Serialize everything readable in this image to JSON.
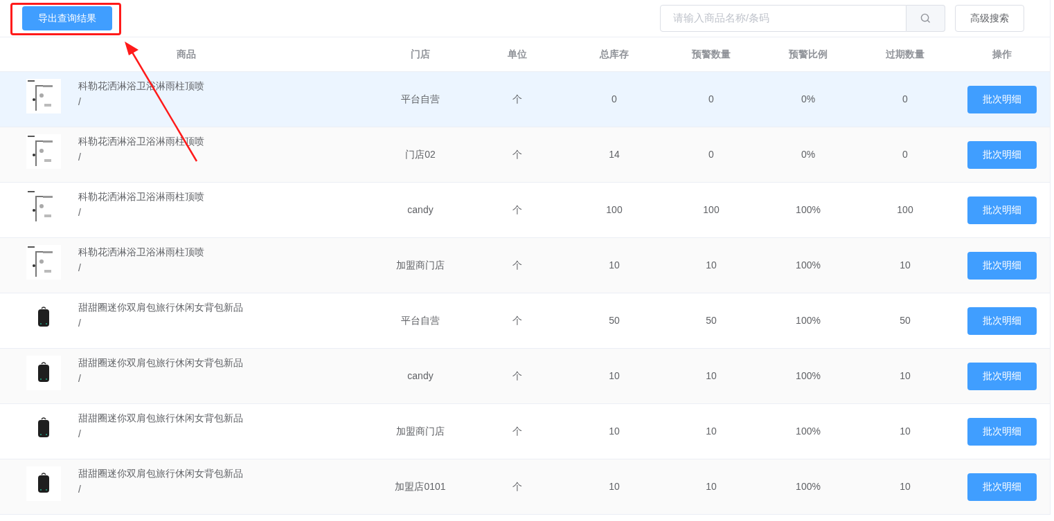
{
  "toolbar": {
    "export_button": "导出查询结果",
    "search": {
      "placeholder": "请输入商品名称/条码"
    },
    "advanced_search_button": "高级搜索"
  },
  "table": {
    "columns": [
      "商品",
      "门店",
      "单位",
      "总库存",
      "预警数量",
      "预警比例",
      "过期数量",
      "操作"
    ],
    "rows": [
      {
        "kind": "shower",
        "name": "科勒花洒淋浴卫浴淋雨柱顶喷",
        "code": "/",
        "store": "平台自营",
        "unit": "个",
        "stock": "0",
        "warn_qty": "0",
        "warn_ratio": "0%",
        "expired": "0",
        "action": "批次明细",
        "selected": true
      },
      {
        "kind": "shower",
        "name": "科勒花洒淋浴卫浴淋雨柱顶喷",
        "code": "/",
        "store": "门店02",
        "unit": "个",
        "stock": "14",
        "warn_qty": "0",
        "warn_ratio": "0%",
        "expired": "0",
        "action": "批次明细",
        "selected": false
      },
      {
        "kind": "shower",
        "name": "科勒花洒淋浴卫浴淋雨柱顶喷",
        "code": "/",
        "store": "candy",
        "unit": "个",
        "stock": "100",
        "warn_qty": "100",
        "warn_ratio": "100%",
        "expired": "100",
        "action": "批次明细",
        "selected": false
      },
      {
        "kind": "shower",
        "name": "科勒花洒淋浴卫浴淋雨柱顶喷",
        "code": "/",
        "store": "加盟商门店",
        "unit": "个",
        "stock": "10",
        "warn_qty": "10",
        "warn_ratio": "100%",
        "expired": "10",
        "action": "批次明细",
        "selected": false
      },
      {
        "kind": "backpack",
        "name": "甜甜圈迷你双肩包旅行休闲女背包新品",
        "code": "/",
        "store": "平台自营",
        "unit": "个",
        "stock": "50",
        "warn_qty": "50",
        "warn_ratio": "100%",
        "expired": "50",
        "action": "批次明细",
        "selected": false
      },
      {
        "kind": "backpack",
        "name": "甜甜圈迷你双肩包旅行休闲女背包新品",
        "code": "/",
        "store": "candy",
        "unit": "个",
        "stock": "10",
        "warn_qty": "10",
        "warn_ratio": "100%",
        "expired": "10",
        "action": "批次明细",
        "selected": false
      },
      {
        "kind": "backpack",
        "name": "甜甜圈迷你双肩包旅行休闲女背包新品",
        "code": "/",
        "store": "加盟商门店",
        "unit": "个",
        "stock": "10",
        "warn_qty": "10",
        "warn_ratio": "100%",
        "expired": "10",
        "action": "批次明细",
        "selected": false
      },
      {
        "kind": "backpack",
        "name": "甜甜圈迷你双肩包旅行休闲女背包新品",
        "code": "/",
        "store": "加盟店0101",
        "unit": "个",
        "stock": "10",
        "warn_qty": "10",
        "warn_ratio": "100%",
        "expired": "10",
        "action": "批次明细",
        "selected": false
      }
    ]
  }
}
